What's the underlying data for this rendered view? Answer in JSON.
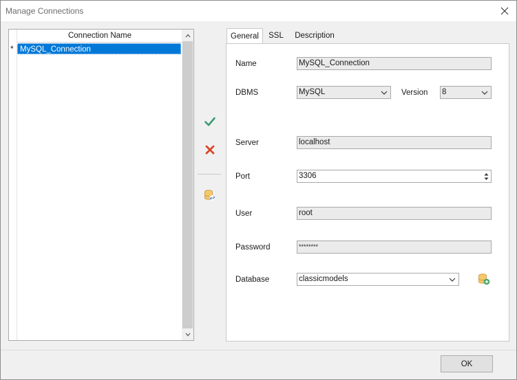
{
  "window": {
    "title": "Manage Connections"
  },
  "grid": {
    "column_header": "Connection Name",
    "rows": [
      {
        "indicator": "*",
        "name": "MySQL_Connection",
        "selected": true
      }
    ]
  },
  "toolbar": {
    "icons": [
      "checkmark-icon",
      "delete-x-icon",
      "database-link-icon"
    ],
    "colors": {
      "check": "#3a9a6e",
      "delete": "#d9462b"
    }
  },
  "tabs": [
    {
      "label": "General",
      "active": true
    },
    {
      "label": "SSL",
      "active": false
    },
    {
      "label": "Description",
      "active": false
    }
  ],
  "form": {
    "name": {
      "label": "Name",
      "value": "MySQL_Connection"
    },
    "dbms": {
      "label": "DBMS",
      "value": "MySQL"
    },
    "version": {
      "label": "Version",
      "value": "8"
    },
    "server": {
      "label": "Server",
      "value": "localhost"
    },
    "port": {
      "label": "Port",
      "value": "3306"
    },
    "user": {
      "label": "User",
      "value": "root"
    },
    "password": {
      "label": "Password",
      "value": "********"
    },
    "database": {
      "label": "Database",
      "value": "classicmodels"
    }
  },
  "footer": {
    "ok_label": "OK"
  },
  "colors": {
    "selection": "#0078d7"
  }
}
